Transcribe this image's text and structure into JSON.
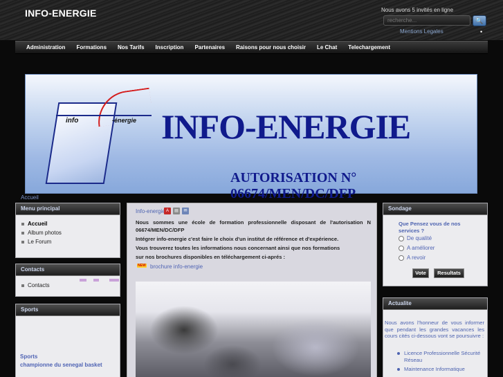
{
  "header": {
    "site_title": "INFO-ENERGIE",
    "guests_text": "Nous avons 5 invités en ligne",
    "search_placeholder": "recherche...",
    "search_button": "🔍",
    "legal_link": "Mentions Legales",
    "legal_dot": "•"
  },
  "nav": {
    "items": [
      "Administration",
      "Formations",
      "Nos Tarifs",
      "Inscription",
      "Partenaires",
      "Raisons pour nous choisir",
      "Le Chat",
      "Telechargement"
    ]
  },
  "banner": {
    "logo_info": "info",
    "logo_energie": "-énergie",
    "title": "INFO-ENERGIE",
    "subtitle": "AUTORISATION N° 06674/MEN/DC/DFP"
  },
  "breadcrumb": "Accueil",
  "left_modules": {
    "main_menu": {
      "title": "Menu principal",
      "items": [
        "Accueil",
        "Album photos",
        "Le Forum"
      ]
    },
    "contacts": {
      "title": "Contacts",
      "items": [
        "Contacts"
      ]
    },
    "sports": {
      "title": "Sports",
      "link1": "Sports",
      "link2": "championne du senegal basket"
    }
  },
  "content": {
    "title": "Info-energie",
    "icons": {
      "pdf": "pdf-icon",
      "print": "print-icon",
      "email": "email-icon"
    },
    "paragraph1": "Nous sommes une école de formation professionnelle disposant de l'autorisation N",
    "paragraph1b": "06674/MEN/DC/DFP",
    "paragraph2": "Intégrer info-energie c'est faire le choix d'un institut de référence et d'expérience.",
    "paragraph3": "Vous trouverez toutes les informations nous concernant ainsi que nos formations",
    "paragraph4": "sur nos brochures disponibles en téléchargement ci-aprés :",
    "new_badge": "NEW",
    "brochure_link": "brochure info-energie"
  },
  "right_modules": {
    "poll": {
      "title": "Sondage",
      "question": "Que Pensez vous de nos services ?",
      "options": [
        "De qualité",
        "A améliorer",
        "A revoir"
      ],
      "vote_button": "Vote",
      "results_button": "Resultats"
    },
    "news": {
      "title": "Actualite",
      "text": "Nous avons l'honneur de vous informer que pendant les grandes vacances les cours cités ci-dessous vont se poursuivre :",
      "items": [
        "Licence Professionnelle Sécurité Réseau",
        "Maintenance Informatique"
      ]
    }
  },
  "colors": {
    "accent_link": "#4d63b0",
    "banner_text": "#101a8c",
    "logo_red": "#d41c1c",
    "header_bg": "#0a0a0a"
  }
}
